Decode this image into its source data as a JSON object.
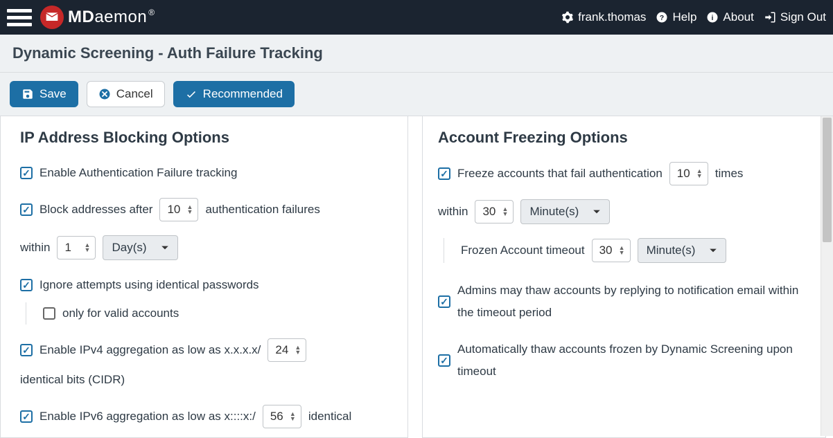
{
  "header": {
    "brand_bold": "MD",
    "brand_rest": "aemon",
    "user": "frank.thomas",
    "help": "Help",
    "about": "About",
    "signout": "Sign Out"
  },
  "subtitle": "Dynamic Screening - Auth Failure Tracking",
  "toolbar": {
    "save": "Save",
    "cancel": "Cancel",
    "recommended": "Recommended"
  },
  "left": {
    "title": "IP Address Blocking Options",
    "enable_tracking": "Enable Authentication Failure tracking",
    "block_after_pre": "Block addresses after",
    "block_after_val": "10",
    "block_after_post": "authentication failures",
    "within_pre": "within",
    "within_val": "1",
    "within_unit": "Day(s)",
    "ignore_identical": "Ignore attempts using identical passwords",
    "only_valid": "only for valid accounts",
    "ipv4_pre": "Enable IPv4 aggregation as low as x.x.x.x/",
    "ipv4_val": "24",
    "ipv4_post": "identical bits (CIDR)",
    "ipv6_pre": "Enable IPv6 aggregation as low as x::::x:/",
    "ipv6_val": "56",
    "ipv6_post": "identical"
  },
  "right": {
    "title": "Account Freezing Options",
    "freeze_pre": "Freeze accounts that fail authentication",
    "freeze_val": "10",
    "freeze_post": "times",
    "within_pre": "within",
    "within_val": "30",
    "within_unit": "Minute(s)",
    "timeout_label": "Frozen Account timeout",
    "timeout_val": "30",
    "timeout_unit": "Minute(s)",
    "admins_thaw": "Admins may thaw accounts by replying to notification email within the timeout period",
    "auto_thaw": "Automatically thaw accounts frozen by Dynamic Screening upon timeout"
  }
}
